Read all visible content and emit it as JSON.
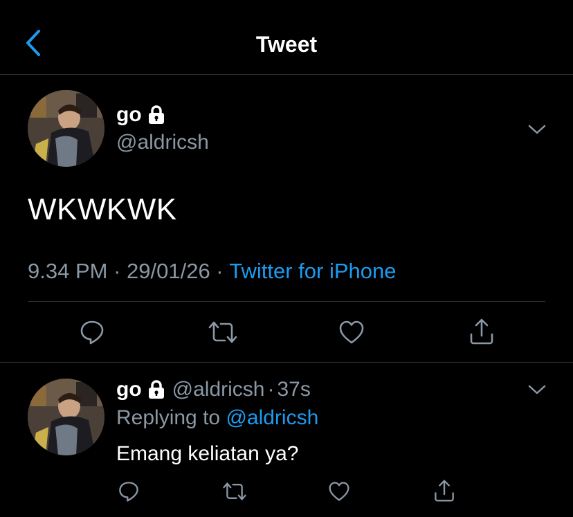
{
  "header": {
    "title": "Tweet",
    "back_icon": "chevron-left-icon",
    "accent_color": "#1d9bf0"
  },
  "tweet": {
    "display_name": "go",
    "protected_icon": "lock-icon",
    "handle": "@aldricsh",
    "text": "WKWKWK",
    "time": "9.34 PM",
    "separator": " · ",
    "date": "29/01/26",
    "source": "Twitter for iPhone",
    "actions": [
      "reply-icon",
      "retweet-icon",
      "like-icon",
      "share-icon"
    ]
  },
  "reply": {
    "display_name": "go",
    "handle": "@aldricsh",
    "dot": "·",
    "time_ago": "37s",
    "replying_prefix": "Replying to ",
    "replying_to": "@aldricsh",
    "text": "Emang keliatan ya?",
    "actions": [
      "reply-icon",
      "retweet-icon",
      "like-icon",
      "share-icon"
    ]
  },
  "colors": {
    "background": "#000000",
    "secondary_text": "#8b98a5",
    "divider": "#2f3336",
    "link": "#1d9bf0"
  }
}
